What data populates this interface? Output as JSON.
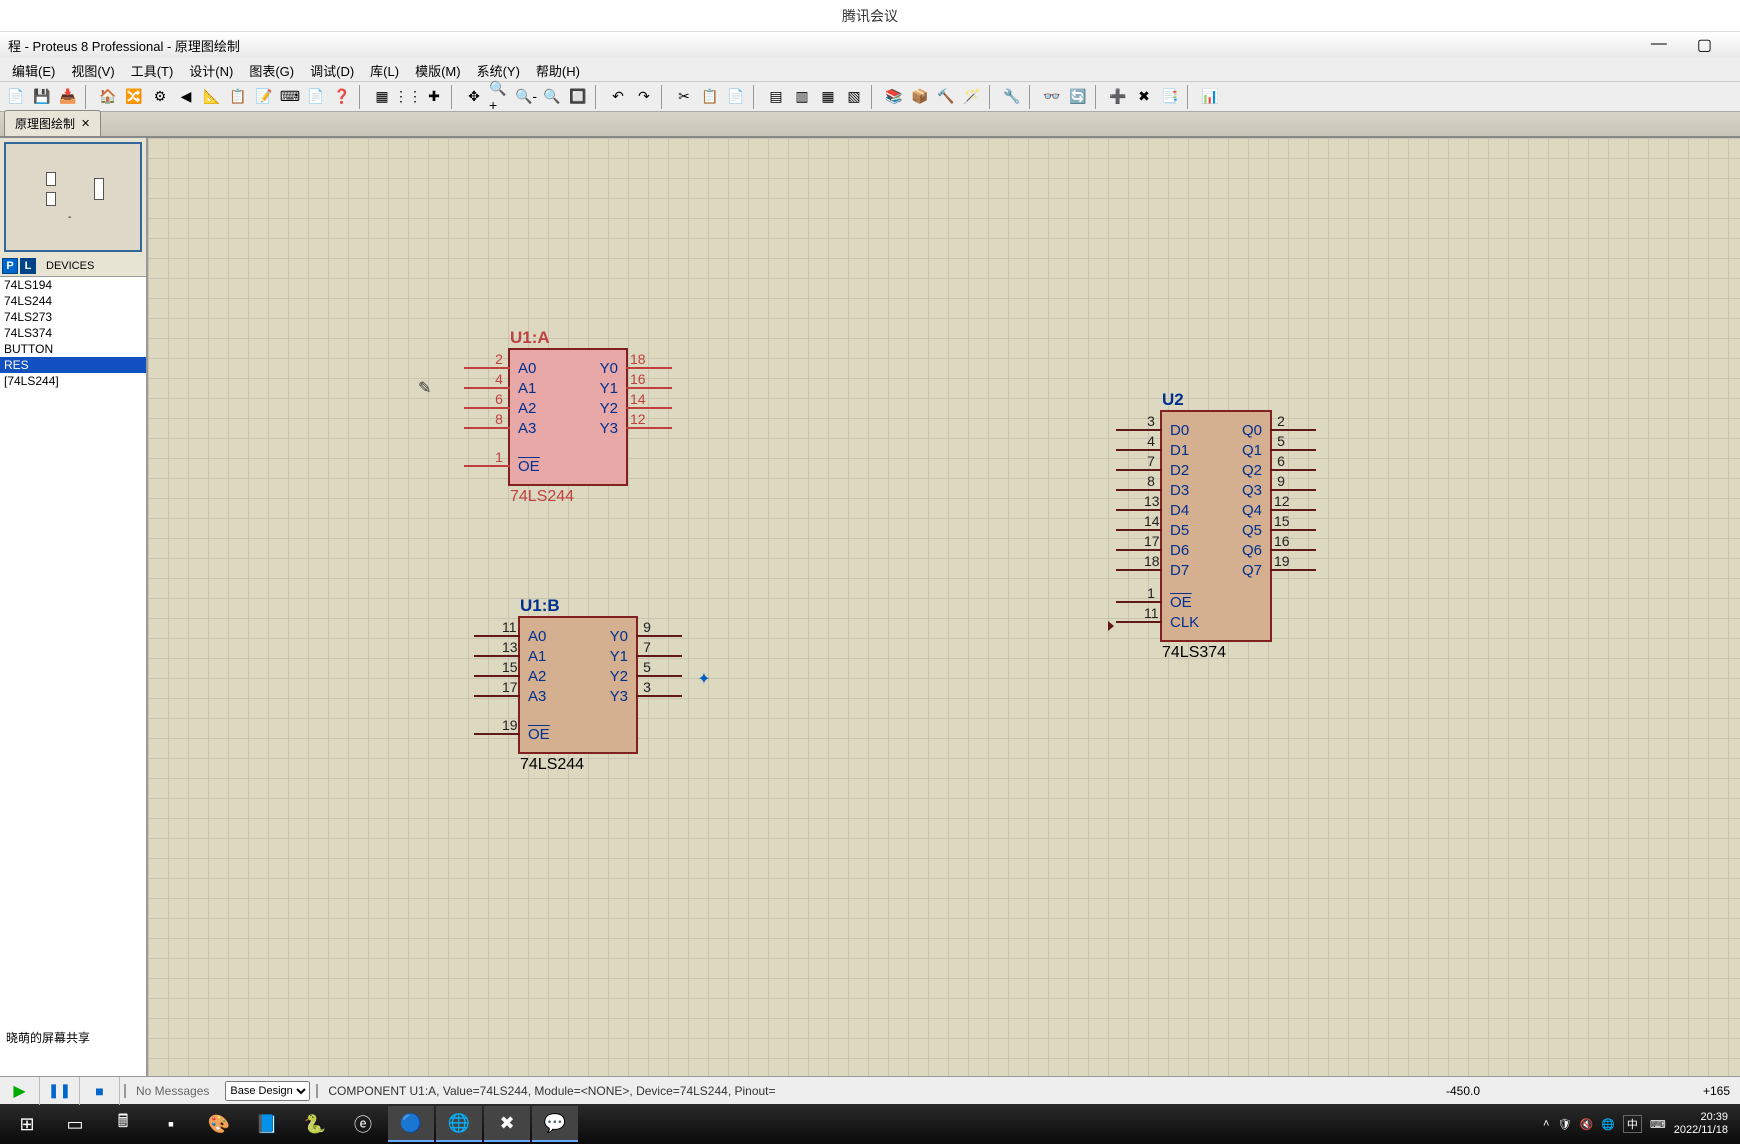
{
  "meeting": {
    "title": "腾讯会议"
  },
  "app": {
    "title": "程 - Proteus 8 Professional - 原理图绘制"
  },
  "menus": [
    "编辑(E)",
    "视图(V)",
    "工具(T)",
    "设计(N)",
    "图表(G)",
    "调试(D)",
    "库(L)",
    "模版(M)",
    "系统(Y)",
    "帮助(H)"
  ],
  "tab": {
    "label": "原理图绘制",
    "close": "✕"
  },
  "picker": {
    "label": "DEVICES",
    "p": "P",
    "l": "L"
  },
  "devices": [
    "74LS194",
    "74LS244",
    "74LS273",
    "74LS374",
    "BUTTON",
    "RES",
    "[74LS244]"
  ],
  "selected_device": "RES",
  "chips": {
    "u1a": {
      "name": "U1:A",
      "type": "74LS244",
      "left": [
        {
          "n": "2",
          "l": "A0"
        },
        {
          "n": "4",
          "l": "A1"
        },
        {
          "n": "6",
          "l": "A2"
        },
        {
          "n": "8",
          "l": "A3"
        },
        {
          "n": "1",
          "l": "OE",
          "ov": true
        }
      ],
      "right": [
        {
          "n": "18",
          "l": "Y0"
        },
        {
          "n": "16",
          "l": "Y1"
        },
        {
          "n": "14",
          "l": "Y2"
        },
        {
          "n": "12",
          "l": "Y3"
        }
      ]
    },
    "u1b": {
      "name": "U1:B",
      "type": "74LS244",
      "left": [
        {
          "n": "11",
          "l": "A0"
        },
        {
          "n": "13",
          "l": "A1"
        },
        {
          "n": "15",
          "l": "A2"
        },
        {
          "n": "17",
          "l": "A3"
        },
        {
          "n": "19",
          "l": "OE",
          "ov": true
        }
      ],
      "right": [
        {
          "n": "9",
          "l": "Y0"
        },
        {
          "n": "7",
          "l": "Y1"
        },
        {
          "n": "5",
          "l": "Y2"
        },
        {
          "n": "3",
          "l": "Y3"
        }
      ]
    },
    "u2": {
      "name": "U2",
      "type": "74LS374",
      "left": [
        {
          "n": "3",
          "l": "D0"
        },
        {
          "n": "4",
          "l": "D1"
        },
        {
          "n": "7",
          "l": "D2"
        },
        {
          "n": "8",
          "l": "D3"
        },
        {
          "n": "13",
          "l": "D4"
        },
        {
          "n": "14",
          "l": "D5"
        },
        {
          "n": "17",
          "l": "D6"
        },
        {
          "n": "18",
          "l": "D7"
        },
        {
          "n": "1",
          "l": "OE",
          "ov": true
        },
        {
          "n": "11",
          "l": "CLK",
          "clk": true
        }
      ],
      "right": [
        {
          "n": "2",
          "l": "Q0"
        },
        {
          "n": "5",
          "l": "Q1"
        },
        {
          "n": "6",
          "l": "Q2"
        },
        {
          "n": "9",
          "l": "Q3"
        },
        {
          "n": "12",
          "l": "Q4"
        },
        {
          "n": "15",
          "l": "Q5"
        },
        {
          "n": "16",
          "l": "Q6"
        },
        {
          "n": "19",
          "l": "Q7"
        }
      ]
    }
  },
  "status": {
    "msg": "No Messages",
    "design": "Base Design",
    "info": "COMPONENT U1:A, Value=74LS244, Module=<NONE>, Device=74LS244, Pinout=",
    "coord1": "-450.0",
    "coord2": "+165"
  },
  "sharing": "晓萌的屏幕共享",
  "clock": {
    "time": "20:39",
    "date": "2022/11/18",
    "ime": "中"
  }
}
